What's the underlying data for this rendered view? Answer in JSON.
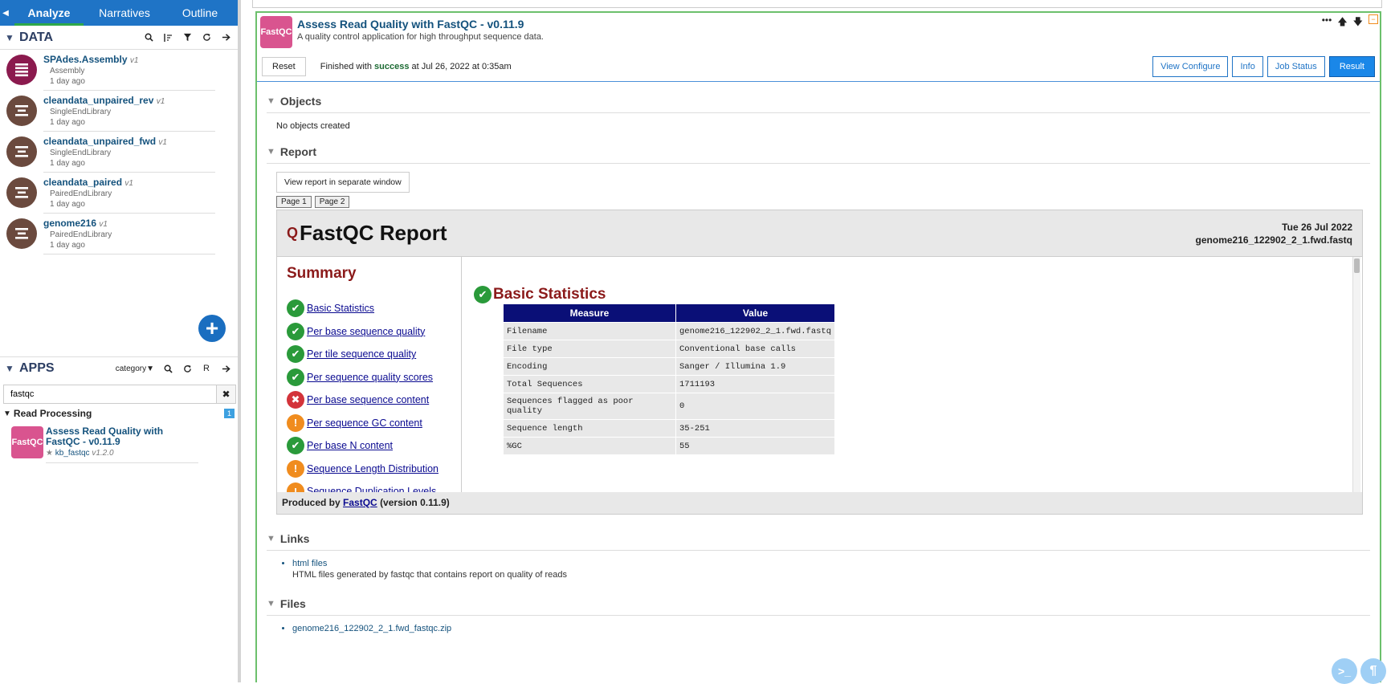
{
  "sidebar": {
    "tabs": [
      {
        "label": "Analyze",
        "active": true
      },
      {
        "label": "Narratives",
        "active": false
      },
      {
        "label": "Outline",
        "active": false
      }
    ],
    "data": {
      "title": "DATA",
      "items": [
        {
          "name": "SPAdes.Assembly",
          "version": "v1",
          "type": "Assembly",
          "time": "1 day ago",
          "color": "#8b1a4e"
        },
        {
          "name": "cleandata_unpaired_rev",
          "version": "v1",
          "type": "SingleEndLibrary",
          "time": "1 day ago",
          "color": "#6b4a3e"
        },
        {
          "name": "cleandata_unpaired_fwd",
          "version": "v1",
          "type": "SingleEndLibrary",
          "time": "1 day ago",
          "color": "#6b4a3e"
        },
        {
          "name": "cleandata_paired",
          "version": "v1",
          "type": "PairedEndLibrary",
          "time": "1 day ago",
          "color": "#6b4a3e"
        },
        {
          "name": "genome216",
          "version": "v1",
          "type": "PairedEndLibrary",
          "time": "1 day ago",
          "color": "#6b4a3e"
        }
      ]
    },
    "apps": {
      "title": "APPS",
      "filter_label": "category",
      "search_value": "fastqc",
      "category": "Read Processing",
      "category_count": "1",
      "items": [
        {
          "logo": "FastQC",
          "name": "Assess Read Quality with FastQC - v0.11.9",
          "module": "kb_fastqc",
          "module_version": "v1.2.0"
        }
      ]
    }
  },
  "cell": {
    "logo": "FastQC",
    "title": "Assess Read Quality with FastQC - v0.11.9",
    "subtitle": "A quality control application for high throughput sequence data.",
    "reset_label": "Reset",
    "status_prefix": "Finished with",
    "status_word": "success",
    "status_suffix": "at Jul 26, 2022 at 0:35am",
    "buttons": [
      "View Configure",
      "Info",
      "Job Status",
      "Result"
    ]
  },
  "objects": {
    "title": "Objects",
    "text": "No objects created"
  },
  "report": {
    "title": "Report",
    "view_button": "View report in separate window",
    "pages": [
      "Page 1",
      "Page 2"
    ],
    "heading": "FastQC Report",
    "date": "Tue 26 Jul 2022",
    "file": "genome216_122902_2_1.fwd.fastq",
    "summary_title": "Summary",
    "summary": [
      {
        "label": "Basic Statistics",
        "status": "pass"
      },
      {
        "label": "Per base sequence quality",
        "status": "pass"
      },
      {
        "label": "Per tile sequence quality",
        "status": "pass"
      },
      {
        "label": "Per sequence quality scores",
        "status": "pass"
      },
      {
        "label": "Per base sequence content",
        "status": "fail"
      },
      {
        "label": "Per sequence GC content",
        "status": "warn"
      },
      {
        "label": "Per base N content",
        "status": "pass"
      },
      {
        "label": "Sequence Length Distribution",
        "status": "warn"
      },
      {
        "label": "Sequence Duplication Levels",
        "status": "warn"
      }
    ],
    "section_title": "Basic Statistics",
    "table_headers": [
      "Measure",
      "Value"
    ],
    "table_rows": [
      [
        "Filename",
        "genome216_122902_2_1.fwd.fastq"
      ],
      [
        "File type",
        "Conventional base calls"
      ],
      [
        "Encoding",
        "Sanger / Illumina 1.9"
      ],
      [
        "Total Sequences",
        "1711193"
      ],
      [
        "Sequences flagged as poor quality",
        "0"
      ],
      [
        "Sequence length",
        "35-251"
      ],
      [
        "%GC",
        "55"
      ]
    ],
    "footer_prefix": "Produced by",
    "footer_link": "FastQC",
    "footer_suffix": "(version 0.11.9)"
  },
  "links": {
    "title": "Links",
    "items": [
      {
        "label": "html files",
        "description": "HTML files generated by fastqc that contains report on quality of reads"
      }
    ]
  },
  "files": {
    "title": "Files",
    "items": [
      "genome216_122902_2_1.fwd_fastqc.zip"
    ]
  }
}
